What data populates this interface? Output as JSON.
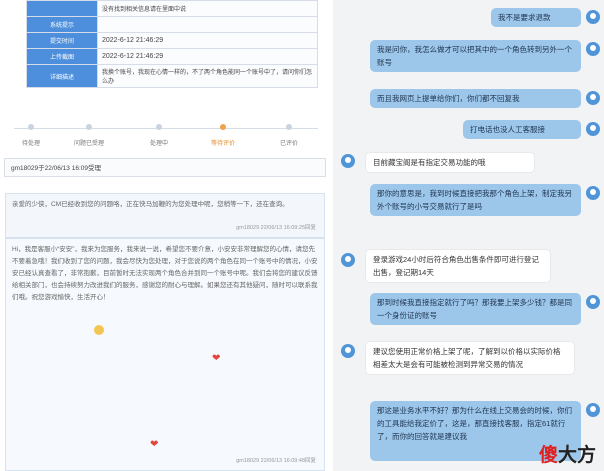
{
  "ticket": {
    "rows": [
      {
        "label": "",
        "value": "没有找到相关信息请在里面中说"
      },
      {
        "label": "系统提示",
        "value": ""
      },
      {
        "label": "提交时间",
        "value": "2022-6-12 21:46:29"
      },
      {
        "label": "上传截图",
        "value": "2022-6-12 21:46:29"
      },
      {
        "label": "详细描述",
        "value": "我换个账号，我现在心情一样的，不了两个角色能同一个账号中了，请问你们怎么办"
      }
    ]
  },
  "steps": [
    {
      "label": "待处理"
    },
    {
      "label": "问题已受理"
    },
    {
      "label": "处理中"
    },
    {
      "label": "等待评价"
    },
    {
      "label": "已评价"
    }
  ],
  "time_bar": "gm18029于22/06/13 16:09受理",
  "messages": [
    {
      "body": "亲爱的少侠，CM已经收到您的问题咯，正在快马加鞭的为您处理中呢，您稍等一下，还在查询。",
      "meta": "gm18029 22/06/13 16:09:25回复"
    },
    {
      "body": "Hi，我是客服小“安安”，我来为您服务，我来说一说，希望您不要介意，小安安非常理解您的心情，请您先不要着急哦！我们收到了您的问题，我会尽快为您处理，对于您说的两个角色在同一个账号中的情况，小安安已经认真查看了，非常抱歉，目前暂时无法实现两个角色合并到同一个账号中呢。我们会将您的建议反馈给相关部门，也会持续努力改进我们的服务，感谢您的耐心与理解。如果您还有其他疑问，随时可以联系我们哦。祝您游戏愉快，生活开心！",
      "meta": "gm18029 22/06/13 16:09:48回复"
    }
  ],
  "chat": [
    {
      "side": "me",
      "text": "我不是要求退款"
    },
    {
      "side": "me",
      "text": "我是问你，我怎么做才可以把其中的一个角色转到另外一个账号"
    },
    {
      "side": "me",
      "text": "而且我网页上提单给你们，你们都不回复我"
    },
    {
      "side": "me",
      "text": "打电话也没人工客服接"
    },
    {
      "side": "them",
      "text": "目前藏宝阁是有指定交易功能的哦"
    },
    {
      "side": "me",
      "text": "那你的意思是，我到时候直接把我那个角色上架，制定我另外个账号的小号交易就行了是吗"
    },
    {
      "side": "them",
      "text": "登录游戏24小时后符合角色出售条件即可进行登记出售，登记期14天"
    },
    {
      "side": "me",
      "text": "那到时候我直接指定就行了吗？那我要上架多少钱？都是同一个身份证的账号"
    },
    {
      "side": "them",
      "text": "建议您使用正常价格上架了呢，了解到以价格以实际价格相差太大是会有可能被检测到异常交易的情况"
    },
    {
      "side": "me",
      "text": "那这是业务水平不好？那为什么在线上交易会的时候，你们的工具能给我定价了，这是，那直接找客服，指定61就行了，而你的回答就是建议我"
    }
  ],
  "watermark": {
    "part1": "傻",
    "part2": "大方"
  }
}
